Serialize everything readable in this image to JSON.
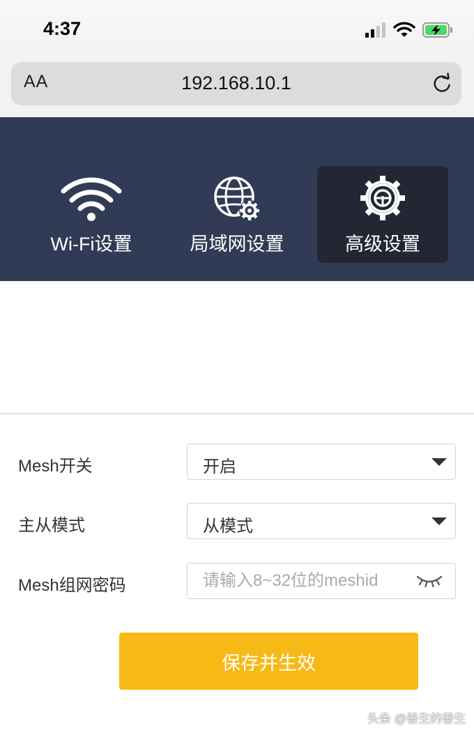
{
  "status_bar": {
    "time": "4:37",
    "icons": [
      "signal-icon",
      "wifi-icon",
      "battery-charging-icon"
    ],
    "battery_color": "#4cd964"
  },
  "browser": {
    "reader_label": "AA",
    "url": "192.168.10.1",
    "reload_icon": "reload-icon"
  },
  "nav": {
    "background": "#323b55",
    "active_background": "#222733",
    "tabs": [
      {
        "label": "Wi-Fi设置",
        "icon": "wifi-icon",
        "active": false
      },
      {
        "label": "局域网设置",
        "icon": "globe-gear-icon",
        "active": false
      },
      {
        "label": "高级设置",
        "icon": "settings-gear-icon",
        "active": true
      }
    ]
  },
  "form": {
    "mesh_switch": {
      "label": "Mesh开关",
      "value": "开启"
    },
    "mode": {
      "label": "主从模式",
      "value": "从模式"
    },
    "password": {
      "label": "Mesh组网密码",
      "placeholder": "请输入8~32位的meshid",
      "value": ""
    }
  },
  "save_button": {
    "label": "保存并生效",
    "color": "#f6b916"
  },
  "watermark": "头条 @善生的善生"
}
